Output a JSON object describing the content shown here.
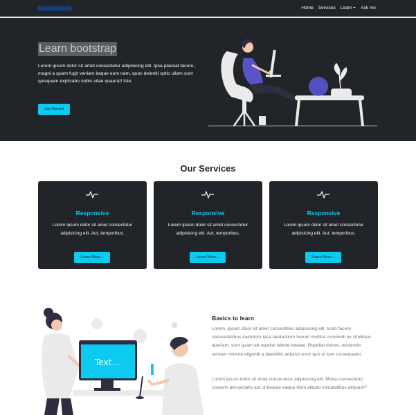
{
  "navbar": {
    "brand": "bootstrap tutorial",
    "links": [
      "Home",
      "Services",
      "Learn",
      "Ask me"
    ]
  },
  "hero": {
    "title": "Learn bootstrap",
    "text": "Lorem ipsum dolor sit amet consectetur adipisicing elit. Ipsa placeat facere, magni a quam fugit veniam itaque eum nam, quos deleniti optio ullam sunt quisquam explicabo nobis vitae quaerat! Iste.",
    "button": "Get Started"
  },
  "services": {
    "title": "Our Services",
    "cards": [
      {
        "icon": "activity-icon",
        "title": "Responsive",
        "text": "Lorem ipsum dolor sit amet consectetur adipisicing elit. Aut, temporibus.",
        "button": "Learn More..."
      },
      {
        "icon": "activity-icon",
        "title": "Responsive",
        "text": "Lorem ipsum dolor sit amet consectetur adipisicing elit. Aut, temporibus.",
        "button": "Learn More..."
      },
      {
        "icon": "activity-icon",
        "title": "Responsive",
        "text": "Lorem ipsum dolor sit amet consectetur adipisicing elit. Aut, temporibus.",
        "button": "Learn More..."
      }
    ]
  },
  "basics": {
    "title": "Basics to learn",
    "p1": "Lorem, ipsum dolor sit amet consectetur adipisicing elit. Iusto facere necessitatibus inventore ipsa laudantium harum mollitia commodi ex similique aperiam, sunt quam ab repellat labore beatae. Repellat dolore, reiciendis veniam minima eligendi a blanditiis adipisci error quo et iure consequatur.",
    "p2": "Lorem ipsum dolor sit amet consectetur adipisicing elit. Minus consectetur corporis perspiciatis aut ut beatae eaque illum aliquid voluptatibus aliquam?",
    "screen_text": "Text..."
  },
  "colors": {
    "dark": "#212529",
    "accent": "#0dcaf0",
    "brand_link": "#0d6efd",
    "muted": "#6c757d"
  }
}
